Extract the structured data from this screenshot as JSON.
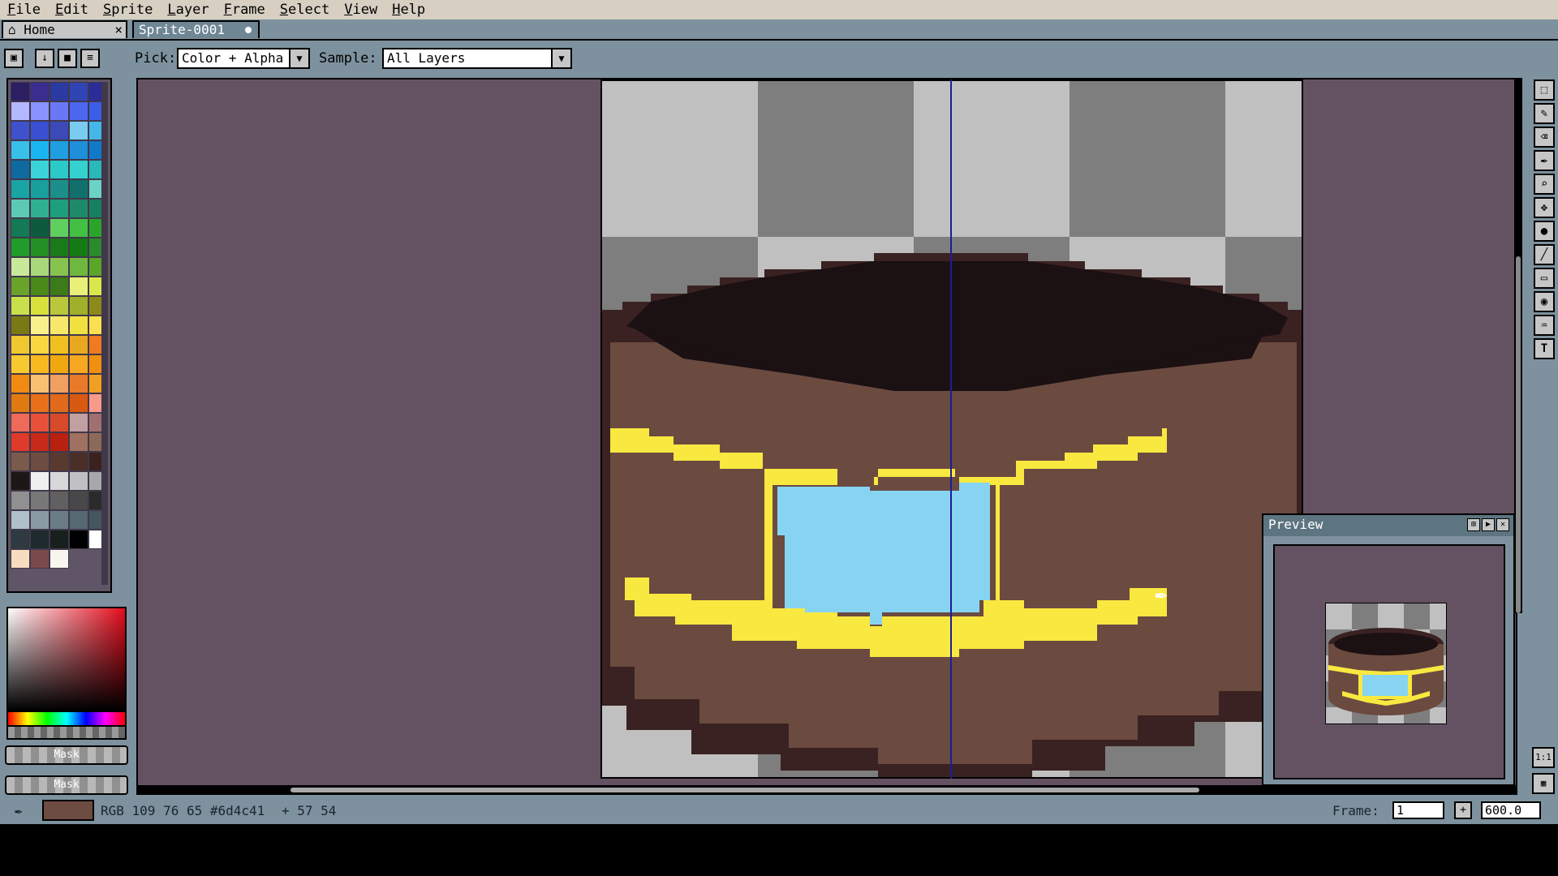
{
  "menu": [
    "File",
    "Edit",
    "Sprite",
    "Layer",
    "Frame",
    "Select",
    "View",
    "Help"
  ],
  "tabs": {
    "home": "Home",
    "home_close": "×",
    "sprite": "Sprite-0001"
  },
  "toolbar": {
    "pick_label": "Pick:",
    "pick_value": "Color + Alpha",
    "sample_label": "Sample:",
    "sample_value": "All Layers",
    "buttons": [
      "lock-icon",
      "arrow-down-icon",
      "stop-icon",
      "menu-icon"
    ]
  },
  "palette": {
    "colors": [
      "#2b1e63",
      "#3a2d8f",
      "#2a3aa0",
      "#3045b3",
      "#2a2c9a",
      "#b3b8ff",
      "#8a92ff",
      "#6a78f5",
      "#4b67f0",
      "#3c5de6",
      "#3f52cc",
      "#3a4fd1",
      "#3b4ab8",
      "#7acbf0",
      "#44b6e8",
      "#38c0e8",
      "#19b6f0",
      "#1f9fe0",
      "#1e8fd8",
      "#1279c8",
      "#0f6aa0",
      "#3ad3d8",
      "#2cc9c9",
      "#35d1cf",
      "#2ab8b8",
      "#1aa5a5",
      "#19a09c",
      "#1c8f8a",
      "#11706c",
      "#6bd3c5",
      "#5cc9b5",
      "#2fb090",
      "#1e9f7c",
      "#1e8a6a",
      "#178060",
      "#127a55",
      "#0e5a3d",
      "#5fd05f",
      "#43c043",
      "#2aa52a",
      "#1f9c2a",
      "#248f24",
      "#1a7a1a",
      "#147a14",
      "#2b8a2b",
      "#c9e89a",
      "#a8d87a",
      "#86c44f",
      "#6fb83f",
      "#5aa52a",
      "#6aa22a",
      "#4b8a1a",
      "#3c7a1a",
      "#e8f07a",
      "#d8e84a",
      "#c9e04a",
      "#d8e03c",
      "#b8c83a",
      "#a0b02a",
      "#8c8a1a",
      "#7a7a14",
      "#f8f08a",
      "#f8e86a",
      "#f0e040",
      "#f8e050",
      "#f0c830",
      "#f8d840",
      "#f0c020",
      "#e8a820",
      "#f07a20",
      "#f8c830",
      "#f8b820",
      "#f0a810",
      "#f8a820",
      "#f09010",
      "#f08a10",
      "#f8c070",
      "#f0a060",
      "#e87a2a",
      "#f0a020",
      "#e07a10",
      "#e8701a",
      "#e06a1a",
      "#d85a10",
      "#f89a8a",
      "#f06a5a",
      "#e8503a",
      "#d84a2a",
      "#c0a0a0",
      "#a07070",
      "#e03a2a",
      "#c82a1a",
      "#b82010",
      "#a07060",
      "#8c6a5a",
      "#7a5a4a",
      "#6d4c41",
      "#5a3a30",
      "#4a2e28",
      "#3a221e",
      "#1e1616",
      "#f0f0f0",
      "#d8d8d8",
      "#c0c0c0",
      "#a8a8a8",
      "#909090",
      "#787878",
      "#606060",
      "#484848",
      "#2a2a2a",
      "#b0c0c8",
      "#8a9aa2",
      "#6a7c86",
      "#566872",
      "#44565e",
      "#2e3a40",
      "#1f2a2e",
      "#18201e",
      "#000000",
      "#ffffff",
      "#f8dcc0",
      "#7a4a4a",
      "#f8f4ee"
    ]
  },
  "mask_buttons": [
    "Mask",
    "Mask"
  ],
  "preview": {
    "title": "Preview"
  },
  "status": {
    "rgb": "RGB 109 76 65 #6d4c41",
    "coords": "+ 57 54",
    "frame_label": "Frame:",
    "frame_value": "1",
    "zoom_value": "600.0",
    "fg_color": "#6d4c41"
  },
  "ratio_button": "1:1",
  "colors": {
    "canvas_bg": "#645262",
    "ui_bg": "#7d929e",
    "bowl_dark": "#1b1012",
    "bowl_outline": "#3a2222",
    "bowl_body": "#6b4a40",
    "band_yellow": "#f8e840",
    "panel_blue": "#86d4f2"
  }
}
